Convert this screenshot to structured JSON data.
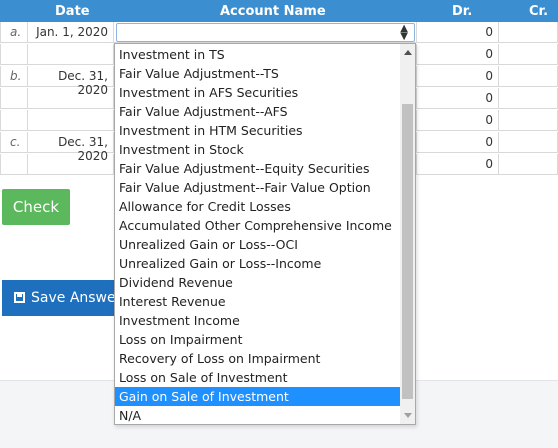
{
  "table": {
    "headers": {
      "date": "Date",
      "account": "Account Name",
      "dr": "Dr.",
      "cr": "Cr."
    },
    "rows": [
      {
        "letter": "a.",
        "date": "Jan. 1, 2020",
        "dr": "0"
      },
      {
        "letter": "",
        "date": "",
        "dr": "0"
      },
      {
        "letter": "b.",
        "date": "Dec. 31, 2020",
        "dr": "0"
      },
      {
        "letter": "",
        "date": "",
        "dr": "0"
      },
      {
        "letter": "",
        "date": "",
        "dr": "0"
      },
      {
        "letter": "c.",
        "date": "Dec. 31, 2020",
        "dr": "0"
      },
      {
        "letter": "",
        "date": "",
        "dr": "0"
      }
    ]
  },
  "select": {
    "value": ""
  },
  "dropdown": {
    "options": [
      "Investment in TS",
      "Fair Value Adjustment--TS",
      "Investment in AFS Securities",
      "Fair Value Adjustment--AFS",
      "Investment in HTM Securities",
      "Investment in Stock",
      "Fair Value Adjustment--Equity Securities",
      "Fair Value Adjustment--Fair Value Option",
      "Allowance for Credit Losses",
      "Accumulated Other Comprehensive Income",
      "Unrealized Gain or Loss--OCI",
      "Unrealized Gain or Loss--Income",
      "Dividend Revenue",
      "Interest Revenue",
      "Investment Income",
      "Loss on Impairment",
      "Recovery of Loss on Impairment",
      "Loss on Sale of Investment",
      "Gain on Sale of Investment",
      "N/A"
    ],
    "highlighted": "Gain on Sale of Investment"
  },
  "buttons": {
    "check": "Check",
    "save": "Save Answers"
  },
  "colors": {
    "header": "#3b8fd0",
    "check": "#5cb85c",
    "save": "#1f6fbf",
    "highlight": "#1e90ff"
  }
}
